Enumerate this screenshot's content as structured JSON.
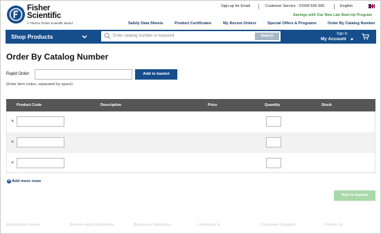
{
  "brand": {
    "name_line1": "Fisher",
    "name_line2": "Scientific",
    "tagline": "A Thermo Fisher Scientific Brand"
  },
  "utility": {
    "signup": "Sign-up for Email",
    "customer_service": "Customer Service - 01509 555 500",
    "language": "English",
    "promo": "Savings with Our New Lab Start-Up Program"
  },
  "nav": [
    "Safety Data Sheets",
    "Product Certificates",
    "My Recent Orders",
    "Special Offers & Programs",
    "Order By Catalog Number"
  ],
  "bar": {
    "shop_products": "Shop Products",
    "search_placeholder": "Enter catalog number or keyword",
    "search_button": "Search",
    "sign_in": "Sign In",
    "my_account": "My Account"
  },
  "page": {
    "title": "Order By Catalog Number",
    "rapid_order_label": "Rapid Order:",
    "rapid_order_value": "",
    "add_to_basket": "Add to basket",
    "hint": "(Enter item codes, separated by space)",
    "add_more_rows": "Add more rows",
    "add_to_basket_bottom": "Add to basket"
  },
  "table": {
    "headers": [
      "Product Code",
      "Description",
      "Price",
      "Quantity",
      "Stock"
    ],
    "rows": [
      {
        "remove": "×",
        "code": "",
        "quantity": ""
      },
      {
        "remove": "×",
        "code": "",
        "quantity": ""
      },
      {
        "remove": "×",
        "code": "",
        "quantity": ""
      }
    ]
  },
  "footer": [
    "Application Areas",
    "Events and Exhibitions",
    "Business Solutions",
    "Literature &",
    "Customer Support",
    "Follow Us"
  ],
  "colors": {
    "brand_blue": "#164e8c",
    "promo_green": "#3f8f3f",
    "disabled_green": "#a9d9a9",
    "table_header": "#565656"
  }
}
